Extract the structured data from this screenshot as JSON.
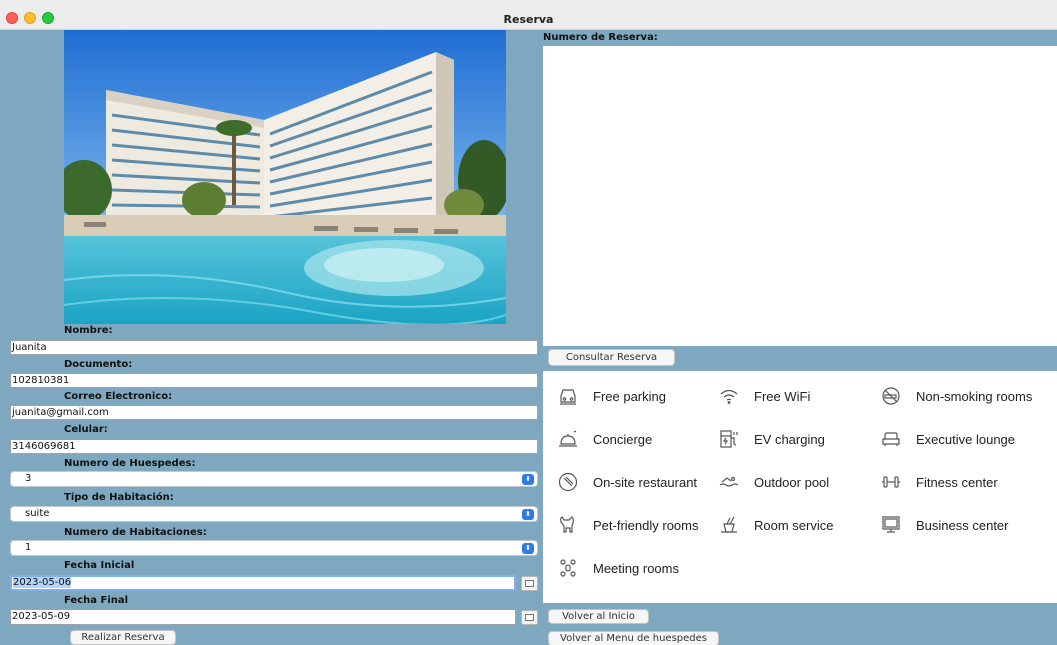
{
  "window": {
    "title": "Reserva"
  },
  "form": {
    "nombre": {
      "label": "Nombre:",
      "value": "Juanita"
    },
    "documento": {
      "label": "Documento:",
      "value": "102810381"
    },
    "correo": {
      "label": "Correo Electronico:",
      "value": "juanita@gmail.com"
    },
    "celular": {
      "label": "Celular:",
      "value": "3146069681"
    },
    "huespedes": {
      "label": "Numero de Huespedes:",
      "value": "3"
    },
    "tipo": {
      "label": "Tipo de Habitación:",
      "value": "suite"
    },
    "habitaciones": {
      "label": "Numero de Habitaciones:",
      "value": "1"
    },
    "fecha_inicial": {
      "label": "Fecha Inicial",
      "value": "2023-05-06"
    },
    "fecha_final": {
      "label": "Fecha Final",
      "value": "2023-05-09"
    },
    "submit_label": "Realizar Reserva"
  },
  "reserva": {
    "label": "Numero de Reserva:",
    "consultar_label": "Consultar Reserva"
  },
  "amenities": [
    {
      "label": "Free parking",
      "icon": "car-icon"
    },
    {
      "label": "Free WiFi",
      "icon": "wifi-icon"
    },
    {
      "label": "Non-smoking rooms",
      "icon": "no-smoking-icon"
    },
    {
      "label": "Concierge",
      "icon": "concierge-bell-icon"
    },
    {
      "label": "EV charging",
      "icon": "ev-charging-icon"
    },
    {
      "label": "Executive lounge",
      "icon": "sofa-icon"
    },
    {
      "label": "On-site restaurant",
      "icon": "restaurant-icon"
    },
    {
      "label": "Outdoor pool",
      "icon": "pool-icon"
    },
    {
      "label": "Fitness center",
      "icon": "dumbbell-icon"
    },
    {
      "label": "Pet-friendly rooms",
      "icon": "pet-icon"
    },
    {
      "label": "Room service",
      "icon": "room-service-icon"
    },
    {
      "label": "Business center",
      "icon": "monitor-icon"
    },
    {
      "label": "Meeting rooms",
      "icon": "meeting-icon"
    }
  ],
  "nav": {
    "inicio_label": "Volver al Inicio",
    "menu_label": "Volver al Menu de huespedes"
  }
}
